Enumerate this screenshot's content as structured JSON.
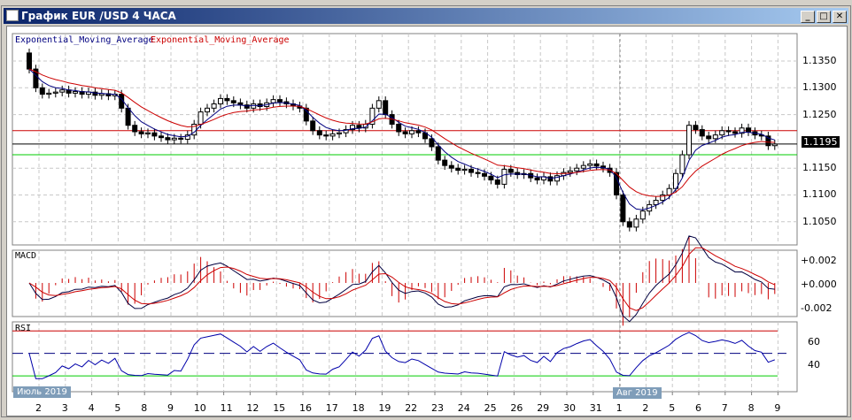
{
  "window": {
    "title": "График EUR /USD  4 ЧАСА",
    "minimize": "_",
    "maximize": "□",
    "close": "✕"
  },
  "main": {
    "legend_blue": "Exponential_Moving_Average",
    "legend_red": "Exponential_Moving_Average",
    "current_price": "1.1195",
    "price_ticks": [
      "1.1350",
      "1.1300",
      "1.1250",
      "1.1150",
      "1.1100",
      "1.1050"
    ],
    "levels": {
      "red": 1.122,
      "black": 1.1195,
      "green": 1.1175
    }
  },
  "macd": {
    "label": "MACD",
    "ticks": [
      "+0.002",
      "+0.000",
      "-0.002"
    ]
  },
  "rsi": {
    "label": "RSI",
    "ticks": [
      "60",
      "40"
    ]
  },
  "months": [
    "Июль 2019",
    "Авг 2019"
  ],
  "colors": {
    "ema_fast": "#000080",
    "ema_slow": "#cc0000",
    "green": "#00cc00",
    "title": "#0a246a"
  },
  "chart_data": {
    "type": "candlestick",
    "days": [
      "2",
      "3",
      "4",
      "5",
      "8",
      "9",
      "10",
      "11",
      "12",
      "15",
      "16",
      "17",
      "18",
      "19",
      "22",
      "23",
      "24",
      "25",
      "26",
      "29",
      "30",
      "31",
      "1",
      "2",
      "5",
      "6",
      "7",
      "8",
      "9"
    ],
    "closes": [
      [
        1.1335,
        1.13,
        1.1288,
        1.129
      ],
      [
        1.1292,
        1.1296,
        1.129,
        1.1293
      ],
      [
        1.1288,
        1.1292,
        1.1286,
        1.1289
      ],
      [
        1.1285,
        1.1288,
        1.1262,
        1.123
      ],
      [
        1.1218,
        1.1214,
        1.1216,
        1.121
      ],
      [
        1.1207,
        1.1203,
        1.1206,
        1.1204
      ],
      [
        1.1212,
        1.1232,
        1.1255,
        1.1262
      ],
      [
        1.127,
        1.128,
        1.1276,
        1.1272
      ],
      [
        1.1268,
        1.1262,
        1.127,
        1.1265
      ],
      [
        1.1272,
        1.1278,
        1.1274,
        1.127
      ],
      [
        1.1266,
        1.1262,
        1.1238,
        1.122
      ],
      [
        1.1212,
        1.121,
        1.1214,
        1.1216
      ],
      [
        1.1222,
        1.123,
        1.1225,
        1.1232
      ],
      [
        1.1262,
        1.1276,
        1.125,
        1.1232
      ],
      [
        1.1218,
        1.1214,
        1.122,
        1.1216
      ],
      [
        1.1205,
        1.119,
        1.1165,
        1.1155
      ],
      [
        1.115,
        1.1146,
        1.1148,
        1.1142
      ],
      [
        1.114,
        1.1135,
        1.1128,
        1.112
      ],
      [
        1.1148,
        1.1142,
        1.1138,
        1.114
      ],
      [
        1.1132,
        1.1128,
        1.1134,
        1.1126
      ],
      [
        1.1136,
        1.1142,
        1.1145,
        1.115
      ],
      [
        1.1155,
        1.1158,
        1.1154,
        1.115
      ],
      [
        1.1142,
        1.11,
        1.105,
        1.104
      ],
      [
        1.1055,
        1.107,
        1.1082,
        1.109
      ],
      [
        1.11,
        1.1112,
        1.114,
        1.1175
      ],
      [
        1.123,
        1.1222,
        1.121,
        1.1205
      ],
      [
        1.1212,
        1.122,
        1.1218,
        1.1215
      ],
      [
        1.1225,
        1.1218,
        1.1212,
        1.121
      ],
      [
        1.1192,
        1.1195
      ]
    ],
    "first_open": 1.1365,
    "price_range": [
      1.102,
      1.1385
    ],
    "macd_range": [
      -0.003,
      0.003
    ],
    "rsi_range": [
      16,
      78
    ],
    "rsi_levels": [
      70,
      50,
      30
    ]
  }
}
